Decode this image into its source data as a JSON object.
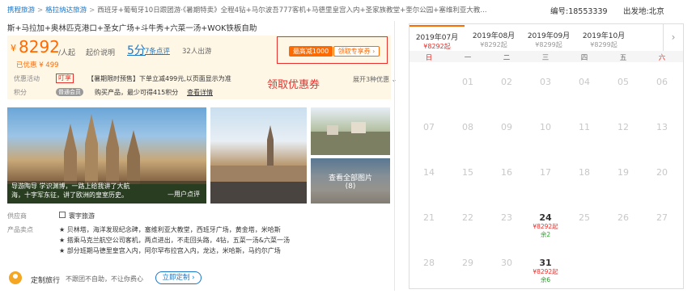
{
  "breadcrumb": {
    "home": "携程旅游",
    "category": "格拉纳达旅游",
    "title": "西班牙+葡萄牙10日跟团游·《暑期特卖》全程4钻+马尔波吾777客机+马德里皇宫入内+圣家族教堂+奎尔公园+塞维利亚大教..."
  },
  "product_no": "编号:18553339",
  "depart": "出发地:北京",
  "subtitle": "斯+马拉加+奥林匹克港口+圣女广场+斗牛秀+六菜一汤+WOK铁板自助",
  "price": {
    "currency": "¥",
    "amount": "8292",
    "per": "/人起",
    "desc": "起价说明",
    "score": "5分",
    "reviews": "7条点评",
    "travelled": "32人出游",
    "discounted": "已优惠 ¥ 499"
  },
  "coupon": {
    "badge": "最高减1000",
    "link": "领取专享券 ›"
  },
  "promo": {
    "label": "优惠活动",
    "tag": "叮享",
    "text": "【暑期限时预售】下单立减499元,以页面显示为准",
    "get_coupon": "领取优惠券",
    "expand": "展开3种优惠 ⌄"
  },
  "points": {
    "label": "积分",
    "member": "普通会员",
    "text": "购买产品，最少可得415积分",
    "detail": "查看详情"
  },
  "photos": {
    "caption": "导游陶导 学识渊博，一路上给我讲了大航海，十字军东征，讲了欧洲的皇室历史。",
    "author": "—用户点评",
    "view_all": "查看全部图片",
    "count": "(8)"
  },
  "supplier": {
    "label": "供应商",
    "name": "寰宇旅游"
  },
  "features": {
    "label": "产品卖点",
    "items": [
      "★ 贝林塔，海洋发现纪念碑，塞维利亚大教堂，西班牙广场，黄金塔，米哈斯",
      "★ 搭乘马克兰航空公司客机，两点进出，不走回头路，4钻，五菜一汤&六菜一汤",
      "★ 部分班期马德里皇宫入内，阿尔罕布拉宫入内，龙达，米哈斯，马约尔广场"
    ]
  },
  "custom": {
    "title": "定制旅行",
    "desc": "不跟团不自助，不让你费心",
    "button": "立即定制 ›"
  },
  "calendar": {
    "months": [
      {
        "m": "2019年07月",
        "p": "¥8292起"
      },
      {
        "m": "2019年08月",
        "p": "¥8292起"
      },
      {
        "m": "2019年09月",
        "p": "¥8299起"
      },
      {
        "m": "2019年10月",
        "p": "¥8299起"
      }
    ],
    "weekdays": [
      "日",
      "一",
      "二",
      "三",
      "四",
      "五",
      "六"
    ],
    "rows": [
      [
        "",
        "01",
        "02",
        "03",
        "04",
        "05",
        "06"
      ],
      [
        "07",
        "08",
        "09",
        "10",
        "11",
        "12",
        "13"
      ],
      [
        "14",
        "15",
        "16",
        "17",
        "18",
        "19",
        "20"
      ],
      [
        "21",
        "22",
        "23",
        "24",
        "25",
        "26",
        "27"
      ],
      [
        "28",
        "29",
        "30",
        "31",
        "",
        "",
        ""
      ]
    ],
    "d24_price": "¥8292起",
    "d24_left": "余2",
    "d31_price": "¥8292起",
    "d31_left": "余6"
  }
}
